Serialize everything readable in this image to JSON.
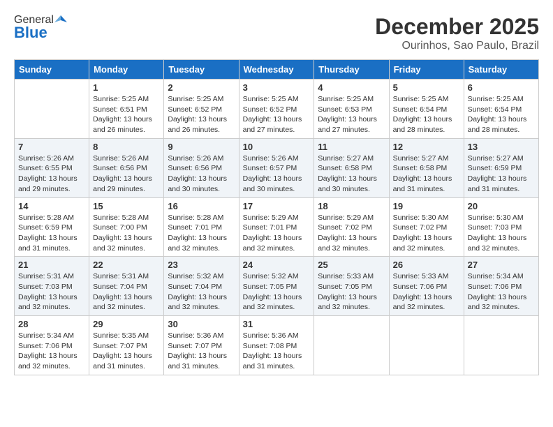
{
  "header": {
    "logo_general": "General",
    "logo_blue": "Blue",
    "month_title": "December 2025",
    "location": "Ourinhos, Sao Paulo, Brazil"
  },
  "days_of_week": [
    "Sunday",
    "Monday",
    "Tuesday",
    "Wednesday",
    "Thursday",
    "Friday",
    "Saturday"
  ],
  "weeks": [
    [
      {
        "day": "",
        "info": ""
      },
      {
        "day": "1",
        "info": "Sunrise: 5:25 AM\nSunset: 6:51 PM\nDaylight: 13 hours\nand 26 minutes."
      },
      {
        "day": "2",
        "info": "Sunrise: 5:25 AM\nSunset: 6:52 PM\nDaylight: 13 hours\nand 26 minutes."
      },
      {
        "day": "3",
        "info": "Sunrise: 5:25 AM\nSunset: 6:52 PM\nDaylight: 13 hours\nand 27 minutes."
      },
      {
        "day": "4",
        "info": "Sunrise: 5:25 AM\nSunset: 6:53 PM\nDaylight: 13 hours\nand 27 minutes."
      },
      {
        "day": "5",
        "info": "Sunrise: 5:25 AM\nSunset: 6:54 PM\nDaylight: 13 hours\nand 28 minutes."
      },
      {
        "day": "6",
        "info": "Sunrise: 5:25 AM\nSunset: 6:54 PM\nDaylight: 13 hours\nand 28 minutes."
      }
    ],
    [
      {
        "day": "7",
        "info": "Sunrise: 5:26 AM\nSunset: 6:55 PM\nDaylight: 13 hours\nand 29 minutes."
      },
      {
        "day": "8",
        "info": "Sunrise: 5:26 AM\nSunset: 6:56 PM\nDaylight: 13 hours\nand 29 minutes."
      },
      {
        "day": "9",
        "info": "Sunrise: 5:26 AM\nSunset: 6:56 PM\nDaylight: 13 hours\nand 30 minutes."
      },
      {
        "day": "10",
        "info": "Sunrise: 5:26 AM\nSunset: 6:57 PM\nDaylight: 13 hours\nand 30 minutes."
      },
      {
        "day": "11",
        "info": "Sunrise: 5:27 AM\nSunset: 6:58 PM\nDaylight: 13 hours\nand 30 minutes."
      },
      {
        "day": "12",
        "info": "Sunrise: 5:27 AM\nSunset: 6:58 PM\nDaylight: 13 hours\nand 31 minutes."
      },
      {
        "day": "13",
        "info": "Sunrise: 5:27 AM\nSunset: 6:59 PM\nDaylight: 13 hours\nand 31 minutes."
      }
    ],
    [
      {
        "day": "14",
        "info": "Sunrise: 5:28 AM\nSunset: 6:59 PM\nDaylight: 13 hours\nand 31 minutes."
      },
      {
        "day": "15",
        "info": "Sunrise: 5:28 AM\nSunset: 7:00 PM\nDaylight: 13 hours\nand 32 minutes."
      },
      {
        "day": "16",
        "info": "Sunrise: 5:28 AM\nSunset: 7:01 PM\nDaylight: 13 hours\nand 32 minutes."
      },
      {
        "day": "17",
        "info": "Sunrise: 5:29 AM\nSunset: 7:01 PM\nDaylight: 13 hours\nand 32 minutes."
      },
      {
        "day": "18",
        "info": "Sunrise: 5:29 AM\nSunset: 7:02 PM\nDaylight: 13 hours\nand 32 minutes."
      },
      {
        "day": "19",
        "info": "Sunrise: 5:30 AM\nSunset: 7:02 PM\nDaylight: 13 hours\nand 32 minutes."
      },
      {
        "day": "20",
        "info": "Sunrise: 5:30 AM\nSunset: 7:03 PM\nDaylight: 13 hours\nand 32 minutes."
      }
    ],
    [
      {
        "day": "21",
        "info": "Sunrise: 5:31 AM\nSunset: 7:03 PM\nDaylight: 13 hours\nand 32 minutes."
      },
      {
        "day": "22",
        "info": "Sunrise: 5:31 AM\nSunset: 7:04 PM\nDaylight: 13 hours\nand 32 minutes."
      },
      {
        "day": "23",
        "info": "Sunrise: 5:32 AM\nSunset: 7:04 PM\nDaylight: 13 hours\nand 32 minutes."
      },
      {
        "day": "24",
        "info": "Sunrise: 5:32 AM\nSunset: 7:05 PM\nDaylight: 13 hours\nand 32 minutes."
      },
      {
        "day": "25",
        "info": "Sunrise: 5:33 AM\nSunset: 7:05 PM\nDaylight: 13 hours\nand 32 minutes."
      },
      {
        "day": "26",
        "info": "Sunrise: 5:33 AM\nSunset: 7:06 PM\nDaylight: 13 hours\nand 32 minutes."
      },
      {
        "day": "27",
        "info": "Sunrise: 5:34 AM\nSunset: 7:06 PM\nDaylight: 13 hours\nand 32 minutes."
      }
    ],
    [
      {
        "day": "28",
        "info": "Sunrise: 5:34 AM\nSunset: 7:06 PM\nDaylight: 13 hours\nand 32 minutes."
      },
      {
        "day": "29",
        "info": "Sunrise: 5:35 AM\nSunset: 7:07 PM\nDaylight: 13 hours\nand 31 minutes."
      },
      {
        "day": "30",
        "info": "Sunrise: 5:36 AM\nSunset: 7:07 PM\nDaylight: 13 hours\nand 31 minutes."
      },
      {
        "day": "31",
        "info": "Sunrise: 5:36 AM\nSunset: 7:08 PM\nDaylight: 13 hours\nand 31 minutes."
      },
      {
        "day": "",
        "info": ""
      },
      {
        "day": "",
        "info": ""
      },
      {
        "day": "",
        "info": ""
      }
    ]
  ]
}
